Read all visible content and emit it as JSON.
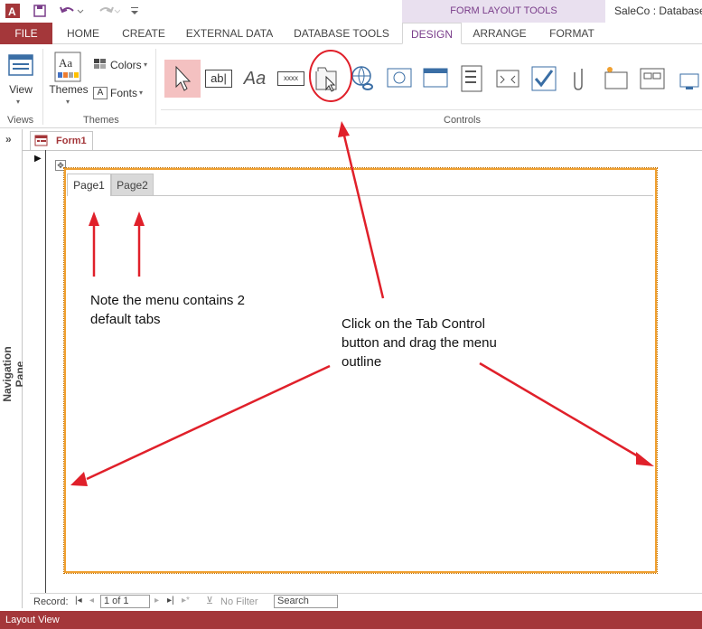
{
  "titlebar": {
    "app_title": "SaleCo : Database-",
    "context_tools": "FORM LAYOUT TOOLS"
  },
  "ribbon_tabs": [
    "FILE",
    "HOME",
    "CREATE",
    "EXTERNAL DATA",
    "DATABASE TOOLS",
    "DESIGN",
    "ARRANGE",
    "FORMAT"
  ],
  "groups": {
    "views": "Views",
    "themes": "Themes",
    "controls": "Controls"
  },
  "buttons": {
    "view": "View",
    "themes": "Themes",
    "colors": "Colors",
    "fonts": "Fonts",
    "label_ctl": "Aa",
    "textbox_ctl": "ab|",
    "button_ctl": "xxxx"
  },
  "nav": {
    "label": "Navigation Pane",
    "collapse": "»"
  },
  "document": {
    "tab": "Form1"
  },
  "tab_control": {
    "tabs": [
      "Page1",
      "Page2"
    ]
  },
  "annotations": {
    "note1": "Note the menu contains 2 default tabs",
    "note2": "Click on the Tab Control button and drag the menu outline"
  },
  "record_nav": {
    "label": "Record:",
    "position": "1 of 1",
    "filter": "No Filter",
    "search": "Search"
  },
  "status": {
    "view": "Layout View"
  },
  "colors": {
    "accent": "#a4373a",
    "context": "#7a3d8a",
    "arrow": "#e0202a",
    "outline": "#f0a030"
  }
}
